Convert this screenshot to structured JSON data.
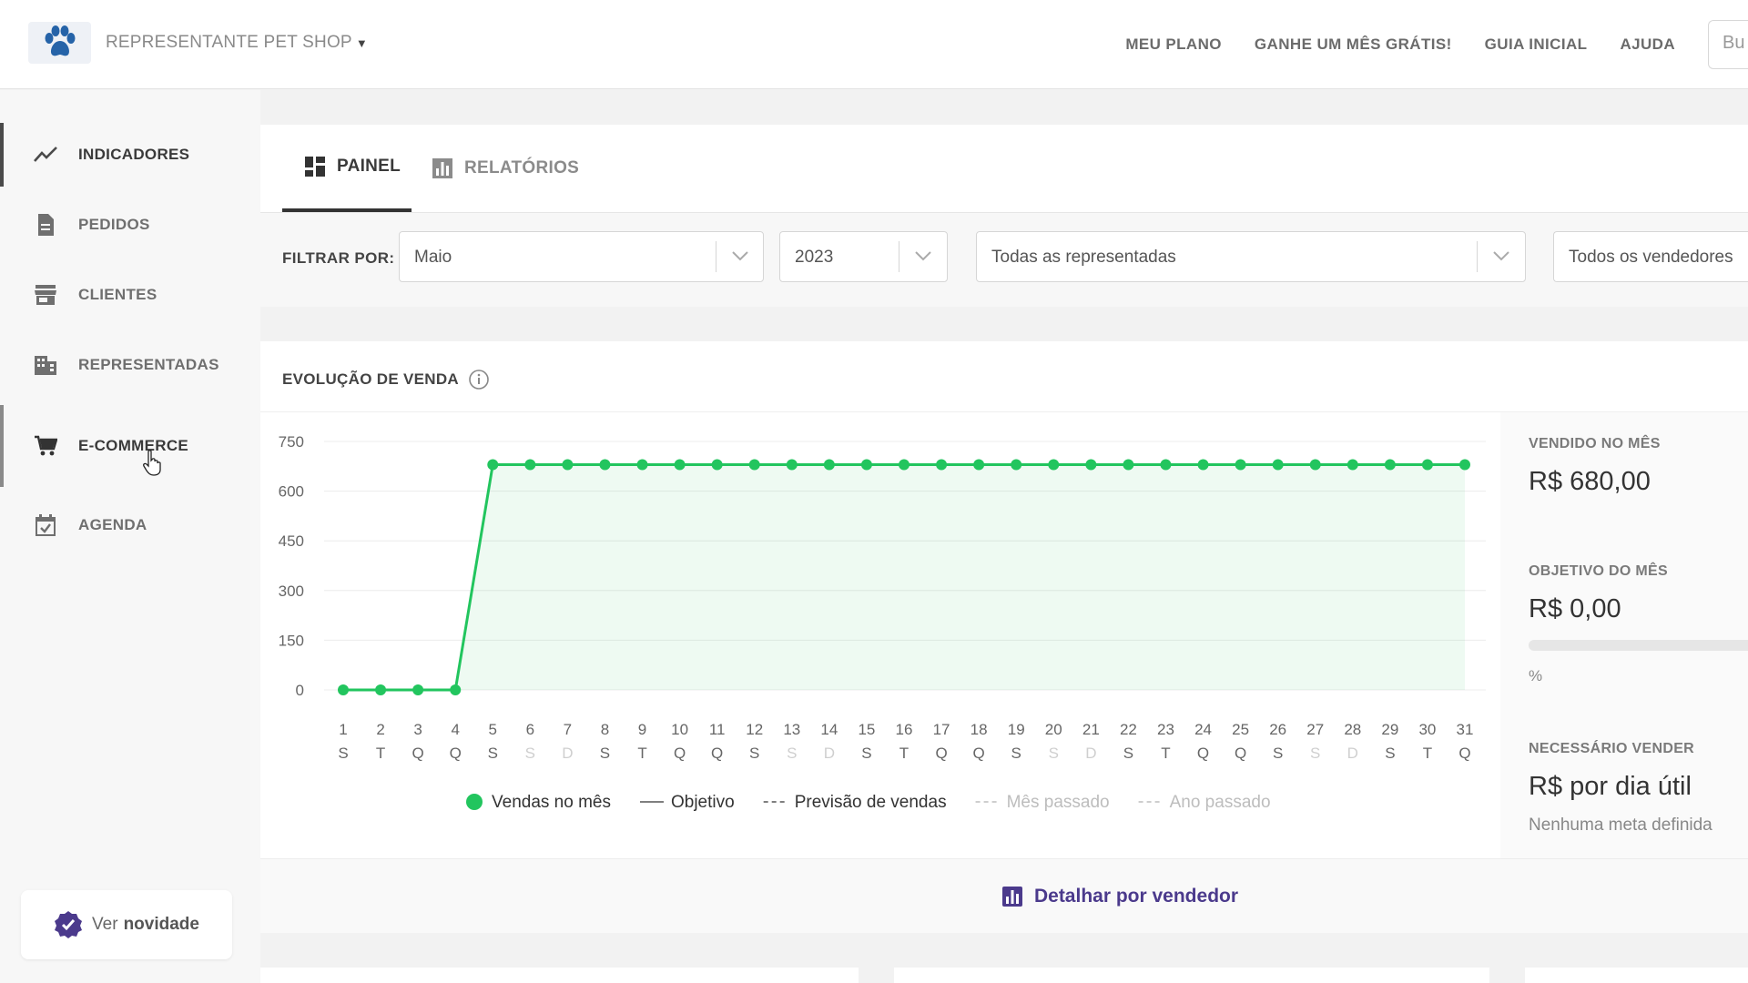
{
  "header": {
    "store_name": "REPRESENTANTE PET SHOP",
    "nav": [
      "MEU PLANO",
      "GANHE UM MÊS GRÁTIS!",
      "GUIA INICIAL",
      "AJUDA"
    ],
    "search_placeholder": "Bu",
    "logo_color": "#2563a8"
  },
  "sidebar": {
    "items": [
      {
        "label": "INDICADORES",
        "icon": "trend-line-icon"
      },
      {
        "label": "PEDIDOS",
        "icon": "document-icon"
      },
      {
        "label": "CLIENTES",
        "icon": "store-icon"
      },
      {
        "label": "REPRESENTADAS",
        "icon": "building-icon"
      },
      {
        "label": "E-COMMERCE",
        "icon": "cart-icon"
      },
      {
        "label": "AGENDA",
        "icon": "calendar-check-icon"
      }
    ],
    "novidade": {
      "prefix": "Ver",
      "bold": "novidade"
    }
  },
  "tabs": [
    {
      "label": "PAINEL",
      "icon": "dashboard-icon"
    },
    {
      "label": "RELATÓRIOS",
      "icon": "bar-chart-icon"
    }
  ],
  "filters": {
    "label": "FILTRAR POR:",
    "month": "Maio",
    "year": "2023",
    "represented": "Todas as representadas",
    "sellers": "Todos os vendedores"
  },
  "chart_section": {
    "title": "EVOLUÇÃO DE VENDA",
    "stats": {
      "sold_label": "VENDIDO NO MÊS",
      "sold_value": "R$ 680,00",
      "goal_label": "OBJETIVO DO MÊS",
      "goal_value": "R$ 0,00",
      "goal_progress": 0,
      "pct_label": "%",
      "need_label": "NECESSÁRIO VENDER",
      "need_value": "R$ por dia útil",
      "need_sub": "Nenhuma meta definida"
    },
    "detail_label": "Detalhar por vendedor"
  },
  "chart_data": {
    "type": "line",
    "ylim": [
      0,
      750
    ],
    "yticks": [
      0,
      150,
      300,
      450,
      600,
      750
    ],
    "x": [
      "1",
      "2",
      "3",
      "4",
      "5",
      "6",
      "7",
      "8",
      "9",
      "10",
      "11",
      "12",
      "13",
      "14",
      "15",
      "16",
      "17",
      "18",
      "19",
      "20",
      "21",
      "22",
      "23",
      "24",
      "25",
      "26",
      "27",
      "28",
      "29",
      "30",
      "31"
    ],
    "x_weekday": [
      "S",
      "T",
      "Q",
      "Q",
      "S",
      "S",
      "D",
      "S",
      "T",
      "Q",
      "Q",
      "S",
      "S",
      "D",
      "S",
      "T",
      "Q",
      "Q",
      "S",
      "S",
      "D",
      "S",
      "T",
      "Q",
      "Q",
      "S",
      "S",
      "D",
      "S",
      "T",
      "Q"
    ],
    "weekend_color": "#cfcfcf",
    "series": [
      {
        "name": "Vendas no mês",
        "color": "#22c55e",
        "values": [
          0,
          0,
          0,
          0,
          680,
          680,
          680,
          680,
          680,
          680,
          680,
          680,
          680,
          680,
          680,
          680,
          680,
          680,
          680,
          680,
          680,
          680,
          680,
          680,
          680,
          680,
          680,
          680,
          680,
          680,
          680
        ]
      }
    ],
    "legend": [
      {
        "label": "Vendas no mês",
        "style": "dot",
        "color": "#22c55e"
      },
      {
        "label": "Objetivo",
        "style": "solid",
        "color": "#555555"
      },
      {
        "label": "Previsão de vendas",
        "style": "dashed",
        "color": "#555555"
      },
      {
        "label": "Mês passado",
        "style": "dashed",
        "color": "#bdbdbd"
      },
      {
        "label": "Ano passado",
        "style": "dashed",
        "color": "#bdbdbd"
      }
    ]
  }
}
